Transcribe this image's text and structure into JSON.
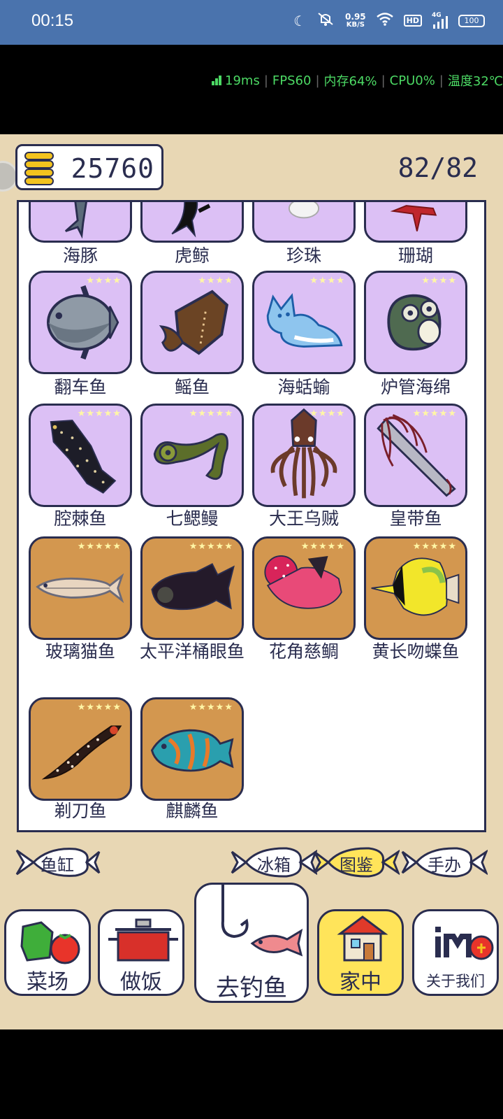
{
  "status_bar": {
    "time": "00:15",
    "speed_value": "0.95",
    "speed_unit": "KB/S",
    "network": "4G",
    "hd": "HD",
    "battery": "100"
  },
  "perf": {
    "ping": "19ms",
    "fps": "FPS60",
    "memory": "内存64%",
    "cpu": "CPU0%",
    "temperature": "温度32℃"
  },
  "coins": {
    "value": "25760"
  },
  "collection_count": "82/82",
  "fish": [
    {
      "name": "海豚",
      "stars": "",
      "bg": "purple"
    },
    {
      "name": "虎鲸",
      "stars": "",
      "bg": "purple"
    },
    {
      "name": "珍珠",
      "stars": "",
      "bg": "purple"
    },
    {
      "name": "珊瑚",
      "stars": "",
      "bg": "purple"
    },
    {
      "name": "翻车鱼",
      "stars": "★★★★",
      "bg": "purple"
    },
    {
      "name": "鳐鱼",
      "stars": "★★★★",
      "bg": "purple"
    },
    {
      "name": "海蛞蝓",
      "stars": "★★★★",
      "bg": "purple"
    },
    {
      "name": "炉管海绵",
      "stars": "★★★★",
      "bg": "purple"
    },
    {
      "name": "腔棘鱼",
      "stars": "★★★★★",
      "bg": "purple"
    },
    {
      "name": "七鳃鳗",
      "stars": "★★★★★",
      "bg": "purple"
    },
    {
      "name": "大王乌贼",
      "stars": "★★★★★",
      "bg": "purple"
    },
    {
      "name": "皇带鱼",
      "stars": "★★★★★",
      "bg": "purple"
    },
    {
      "name": "玻璃猫鱼",
      "stars": "★★★★★",
      "bg": "orange"
    },
    {
      "name": "太平洋桶眼鱼",
      "stars": "★★★★★",
      "bg": "orange"
    },
    {
      "name": "花角慈鲷",
      "stars": "★★★★★",
      "bg": "orange"
    },
    {
      "name": "黄长吻蝶鱼",
      "stars": "★★★★★",
      "bg": "orange"
    },
    {
      "name": "剃刀鱼",
      "stars": "★★★★★",
      "bg": "orange"
    },
    {
      "name": "麒麟鱼",
      "stars": "★★★★★",
      "bg": "orange"
    }
  ],
  "tabs": [
    {
      "label": "鱼缸",
      "active": false
    },
    {
      "label": "冰箱",
      "active": false
    },
    {
      "label": "图鉴",
      "active": true
    },
    {
      "label": "手办",
      "active": false
    }
  ],
  "nav": [
    {
      "label": "菜场",
      "icon": "vegetables-icon"
    },
    {
      "label": "做饭",
      "icon": "cooking-pot-icon"
    },
    {
      "label": "去钓鱼",
      "icon": "fishing-hook-icon"
    },
    {
      "label": "家中",
      "icon": "house-icon",
      "active": true
    },
    {
      "label": "关于我们",
      "icon": "about-us-icon"
    }
  ],
  "colors": {
    "status_bar": "#4a73ad",
    "game_bg": "#e8d7b4",
    "card_purple": "#dcc0f5",
    "card_orange": "#d3974f",
    "outline": "#2a2d4f",
    "active_tab": "#ffe45a",
    "perf_text": "#4cd964"
  }
}
